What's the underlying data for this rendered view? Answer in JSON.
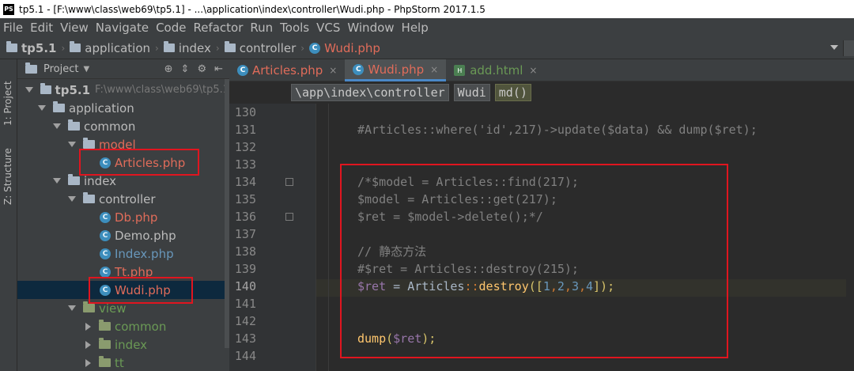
{
  "window": {
    "title": "tp5.1 - [F:\\www\\class\\web69\\tp5.1] - ...\\application\\index\\controller\\Wudi.php - PhpStorm 2017.1.5"
  },
  "menu": [
    "File",
    "Edit",
    "View",
    "Navigate",
    "Code",
    "Refactor",
    "Run",
    "Tools",
    "VCS",
    "Window",
    "Help"
  ],
  "nav": [
    "tp5.1",
    "application",
    "index",
    "controller",
    "Wudi.php"
  ],
  "side_tabs": {
    "project": "1: Project",
    "structure": "Z: Structure"
  },
  "project_panel": {
    "title": "Project",
    "tree": [
      {
        "label": "tp5.1",
        "kind": "root",
        "path": "F:\\www\\class\\web69\\tp5.1"
      },
      {
        "label": "application",
        "kind": "folder"
      },
      {
        "label": "common",
        "kind": "folder"
      },
      {
        "label": "model",
        "kind": "folder"
      },
      {
        "label": "Articles.php",
        "kind": "file"
      },
      {
        "label": "index",
        "kind": "folder"
      },
      {
        "label": "controller",
        "kind": "folder"
      },
      {
        "label": "Db.php",
        "kind": "file"
      },
      {
        "label": "Demo.php",
        "kind": "file"
      },
      {
        "label": "Index.php",
        "kind": "file"
      },
      {
        "label": "Tt.php",
        "kind": "file"
      },
      {
        "label": "Wudi.php",
        "kind": "file"
      },
      {
        "label": "view",
        "kind": "folder"
      },
      {
        "label": "common",
        "kind": "folder"
      },
      {
        "label": "index",
        "kind": "folder"
      },
      {
        "label": "tt",
        "kind": "folder"
      }
    ]
  },
  "tabs": [
    {
      "label": "Articles.php",
      "active": false
    },
    {
      "label": "Wudi.php",
      "active": true
    },
    {
      "label": "add.html",
      "active": false
    }
  ],
  "breadcrumbs": [
    "\\app\\index\\controller",
    "Wudi",
    "md()"
  ],
  "code": {
    "line_numbers": [
      "130",
      "131",
      "132",
      "133",
      "134",
      "135",
      "136",
      "137",
      "138",
      "139",
      "140",
      "141",
      "142",
      "143",
      "144"
    ],
    "current_line": "140",
    "lines": {
      "l131": "#Articles::where('id',217)->update($data) && dump($ret);",
      "l134": "/*$model = Articles::find(217);",
      "l135": "$model = Articles::get(217);",
      "l136": "$ret = $model->delete();*/",
      "l138": "// 静态方法",
      "l139": "#$ret = Articles::destroy(215);",
      "l140": {
        "var": "$ret",
        "eq": " = ",
        "cls": "Articles",
        "op": "::",
        "fn": "destroy",
        "open": "([",
        "n1": "1",
        "c1": ",",
        "n2": "2",
        "c2": ",",
        "n3": "3",
        "c3": ",",
        "n4": "4",
        "close": "]);"
      },
      "l143": {
        "fn": "dump",
        "open": "(",
        "var": "$ret",
        "close": ");"
      }
    }
  },
  "colors": {
    "highlight_box": "#e0151f",
    "accent": "#4a88c7",
    "background": "#2b2b2b"
  }
}
